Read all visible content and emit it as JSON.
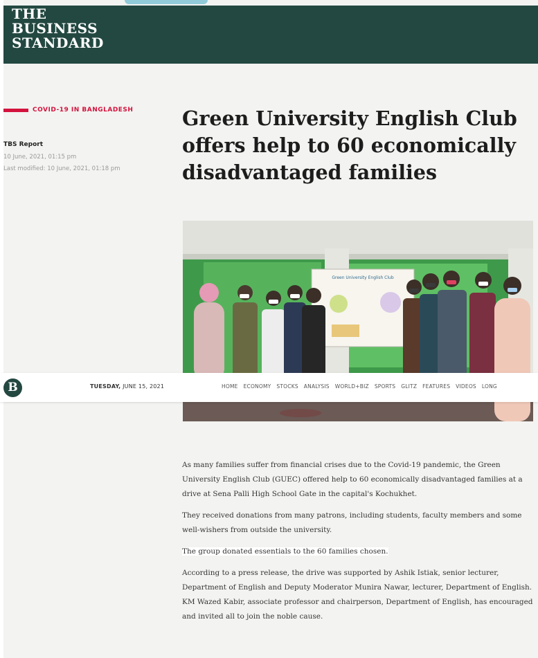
{
  "header": {
    "logo_lines": [
      "THE",
      "BUSINESS",
      "STANDARD"
    ],
    "brand_color": "#234841"
  },
  "article": {
    "section": "COVID-19 IN BANGLADESH",
    "author": "TBS Report",
    "published": "10 June, 2021, 01:15 pm",
    "last_modified": "Last modified: 10 June, 2021, 01:18 pm",
    "headline": "Green University English Club offers help to 60 economically disadvantaged families",
    "photo_banner_text": "Green University English Club",
    "paragraphs": [
      "As many families suffer from financial crises due to the Covid-19 pandemic, the Green University English Club (GUEC) offered help to 60 economically disadvantaged families at a drive at Sena Palli High School Gate in the capital's Kochukhet.",
      "They received donations from many patrons, including students, faculty members and some well-wishers from outside the university.",
      "The group donated essentials to the 60 families chosen.",
      "According to a press release, the drive was supported by Ashik Istiak, senior lecturer, Department of English and Deputy Moderator Munira Nawar, lecturer, Department of English. KM Wazed Kabir, associate professor and chairperson, Department of English, has encouraged and invited all to join the noble cause."
    ]
  },
  "navbar": {
    "logo_letter": "B",
    "day": "TUESDAY,",
    "date": "JUNE 15, 2021",
    "menu": [
      "HOME",
      "ECONOMY",
      "STOCKS",
      "ANALYSIS",
      "WORLD+BIZ",
      "SPORTS",
      "GLITZ",
      "FEATURES",
      "VIDEOS",
      "LONG"
    ]
  },
  "colors": {
    "accent": "#d3123d",
    "paper": "#f3f3f1"
  }
}
